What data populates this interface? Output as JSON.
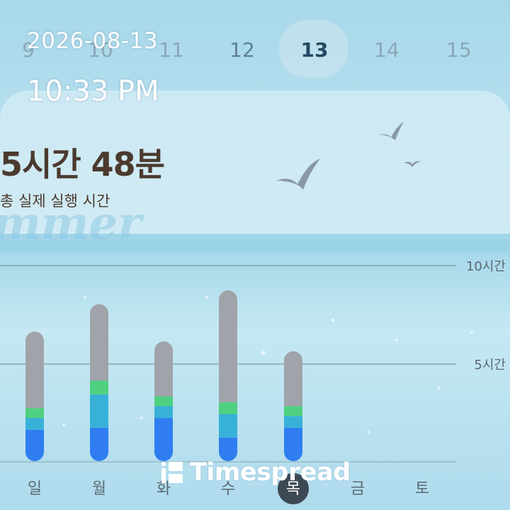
{
  "status_bar": {
    "date": "2026-08-13",
    "time": "10:33 PM"
  },
  "date_strip": {
    "dates": [
      "9",
      "10",
      "11",
      "12",
      "13",
      "14",
      "15"
    ],
    "selected": "13"
  },
  "summary": {
    "total_time": "5시간 48분",
    "label": "총 실제 실행 시간",
    "background_word": "mmer"
  },
  "chart_data": {
    "type": "bar",
    "categories": [
      "일",
      "월",
      "화",
      "수",
      "목",
      "금",
      "토"
    ],
    "selected_category": "목",
    "gridlines": [
      {
        "label": "10시간",
        "value": 10
      },
      {
        "label": "5시간",
        "value": 5
      }
    ],
    "ylim": [
      0,
      10
    ],
    "stacked": true,
    "series": [
      {
        "color": "#2f7df0",
        "values": [
          1.6,
          1.7,
          2.2,
          1.2,
          1.7,
          0,
          0
        ]
      },
      {
        "color": "#38b1d8",
        "values": [
          0.6,
          1.7,
          0.6,
          1.2,
          0.6,
          0,
          0
        ]
      },
      {
        "color": "#4fd080",
        "values": [
          0.5,
          0.7,
          0.5,
          0.6,
          0.5,
          0,
          0
        ]
      },
      {
        "color": "#a1a3aa",
        "values": [
          3.9,
          3.9,
          2.8,
          5.7,
          2.8,
          0,
          0
        ]
      }
    ]
  },
  "watermark": "Timespread",
  "colors": {
    "sky_top": "#9dd3e8",
    "sea": "#bde4f1",
    "text_dark": "#4b3a2e"
  }
}
